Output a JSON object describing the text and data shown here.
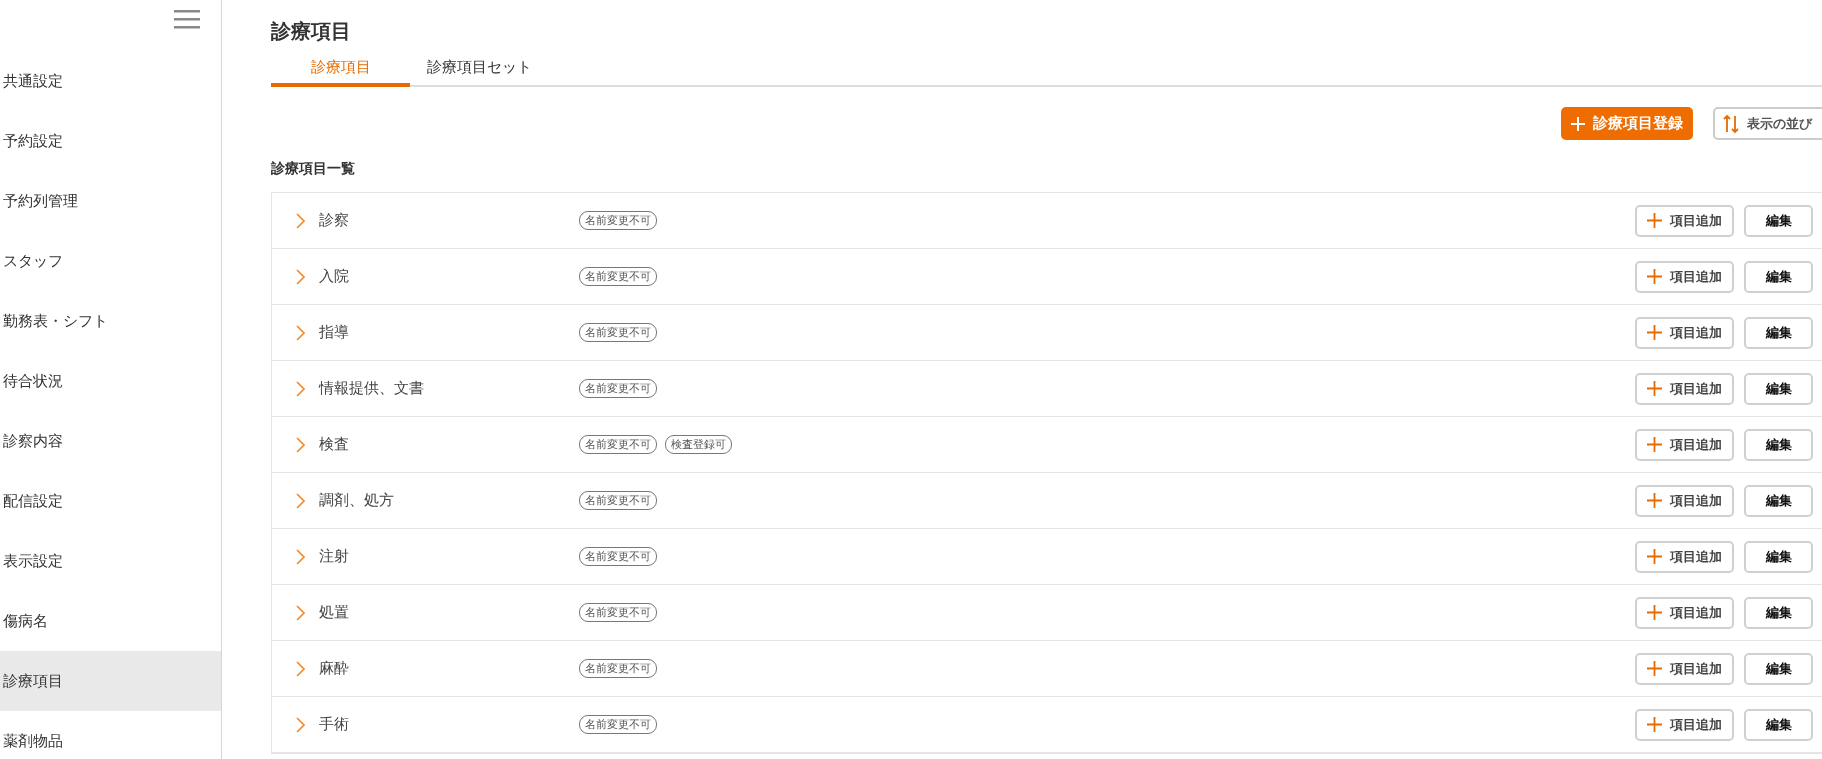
{
  "sidebar": {
    "items": [
      {
        "label": "共通設定",
        "selected": false
      },
      {
        "label": "予約設定",
        "selected": false
      },
      {
        "label": "予約列管理",
        "selected": false
      },
      {
        "label": "スタッフ",
        "selected": false
      },
      {
        "label": "勤務表・シフト",
        "selected": false
      },
      {
        "label": "待合状況",
        "selected": false
      },
      {
        "label": "診察内容",
        "selected": false
      },
      {
        "label": "配信設定",
        "selected": false
      },
      {
        "label": "表示設定",
        "selected": false
      },
      {
        "label": "傷病名",
        "selected": false
      },
      {
        "label": "診療項目",
        "selected": true
      },
      {
        "label": "薬剤物品",
        "selected": false
      }
    ]
  },
  "page_title": "診療項目",
  "tabs": [
    {
      "label": "診療項目",
      "selected": true
    },
    {
      "label": "診療項目セット",
      "selected": false
    }
  ],
  "toolbar": {
    "register_button": "診療項目登録",
    "sort_button": "表示の並び"
  },
  "list": {
    "title": "診療項目一覧",
    "rows": [
      {
        "name": "診察",
        "tags": [
          "名前変更不可"
        ],
        "add_button": "項目追加",
        "edit_button": "編集"
      },
      {
        "name": "入院",
        "tags": [
          "名前変更不可"
        ],
        "add_button": "項目追加",
        "edit_button": "編集"
      },
      {
        "name": "指導",
        "tags": [
          "名前変更不可"
        ],
        "add_button": "項目追加",
        "edit_button": "編集"
      },
      {
        "name": "情報提供、文書",
        "tags": [
          "名前変更不可"
        ],
        "add_button": "項目追加",
        "edit_button": "編集"
      },
      {
        "name": "検査",
        "tags": [
          "名前変更不可",
          "検査登録可"
        ],
        "add_button": "項目追加",
        "edit_button": "編集"
      },
      {
        "name": "調剤、処方",
        "tags": [
          "名前変更不可"
        ],
        "add_button": "項目追加",
        "edit_button": "編集"
      },
      {
        "name": "注射",
        "tags": [
          "名前変更不可"
        ],
        "add_button": "項目追加",
        "edit_button": "編集"
      },
      {
        "name": "処置",
        "tags": [
          "名前変更不可"
        ],
        "add_button": "項目追加",
        "edit_button": "編集"
      },
      {
        "name": "麻酔",
        "tags": [
          "名前変更不可"
        ],
        "add_button": "項目追加",
        "edit_button": "編集"
      },
      {
        "name": "手術",
        "tags": [
          "名前変更不可"
        ],
        "add_button": "項目追加",
        "edit_button": "編集"
      }
    ]
  }
}
